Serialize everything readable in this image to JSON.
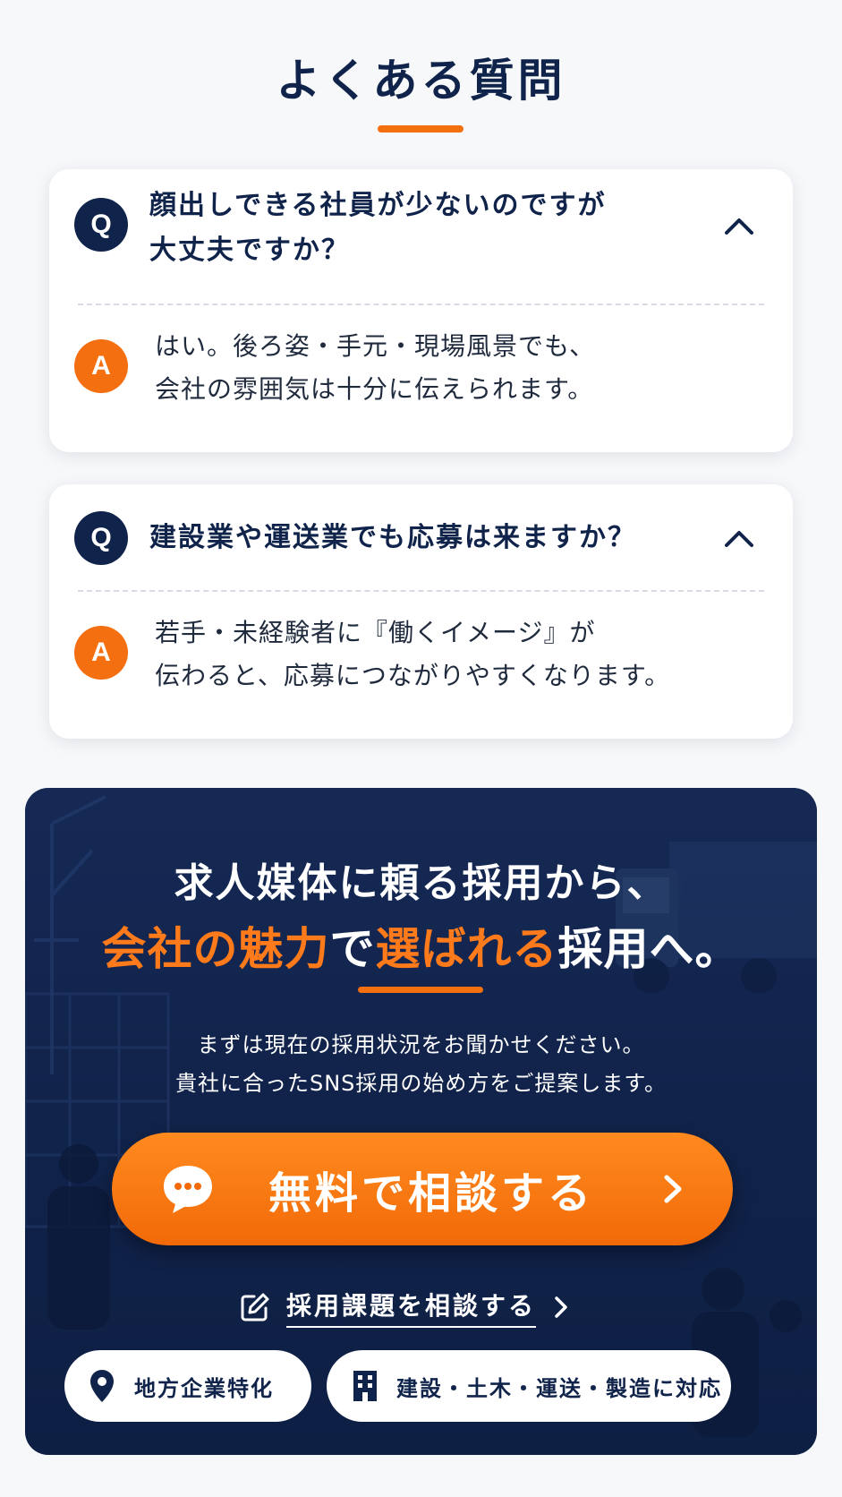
{
  "faq": {
    "title": "よくある質問",
    "items": [
      {
        "q_badge": "Q",
        "question_line1": "顔出しできる社員が少ないのですが",
        "question_line2": "大丈夫ですか？",
        "a_badge": "A",
        "answer_line1": "はい。後ろ姿・手元・現場風景でも、",
        "answer_line2": "会社の雰囲気は十分に伝えられます。"
      },
      {
        "q_badge": "Q",
        "question_line1": "建設業や運送業でも応募は来ますか？",
        "a_badge": "A",
        "answer_line1": "若手・未経験者に『働くイメージ』が",
        "answer_line2": "伝わると、応募につながりやすくなります。"
      }
    ]
  },
  "cta": {
    "headline1": "求人媒体に頼る採用から、",
    "headline2_part1": "会社の魅力",
    "headline2_part2": "で",
    "headline2_part3": "選ばれる",
    "headline2_part4": "採用へ。",
    "desc_line1": "まずは現在の採用状況をお聞かせください。",
    "desc_line2": "貴社に合ったSNS採用の始め方をご提案します。",
    "primary_button": "無料で相談する",
    "secondary_link": "採用課題を相談する",
    "tags": [
      "地方企業特化",
      "建設・土木・運送・製造に対応"
    ]
  },
  "colors": {
    "navy": "#10234a",
    "orange": "#f46f10",
    "background": "#f7f8fa"
  },
  "icons": [
    "chevron-up-icon",
    "chat-bubble-icon",
    "chevron-right-icon",
    "edit-icon",
    "location-pin-icon",
    "building-icon"
  ]
}
